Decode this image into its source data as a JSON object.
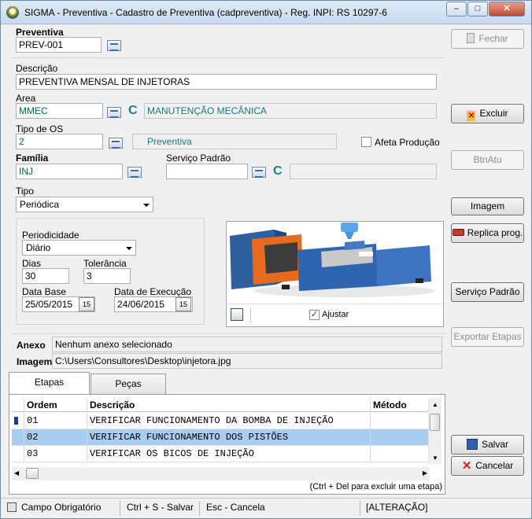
{
  "window": {
    "title": "SIGMA - Preventiva - Cadastro de Preventiva (cadpreventiva) - Reg. INPI: RS 10297-6",
    "controls": [
      "–",
      "□",
      "✕"
    ]
  },
  "form": {
    "preventiva": {
      "label": "Preventiva",
      "value": "PREV-001"
    },
    "descricao": {
      "label": "Descrição",
      "value": "PREVENTIVA MENSAL DE INJETORAS"
    },
    "area": {
      "label": "Area",
      "code": "MMEC",
      "name": "MANUTENÇÃO MECÂNICA"
    },
    "tipo_os": {
      "label": "Tipo de OS",
      "code": "2",
      "name": "Preventiva"
    },
    "afeta_producao": {
      "label": "Afeta Produção",
      "checked": false
    },
    "familia": {
      "label": "Família",
      "value": "INJ"
    },
    "servico_padrao": {
      "label": "Serviço Padrão",
      "value": "",
      "name": ""
    },
    "c_glyph": "C",
    "tipo": {
      "label": "Tipo",
      "selected": "Periódica"
    },
    "periodicidade": {
      "label": "Periodicidade",
      "selected": "Diário"
    },
    "dias": {
      "label": "Dias",
      "value": "30"
    },
    "tolerancia": {
      "label": "Tolerância",
      "value": "3"
    },
    "data_base": {
      "label": "Data Base",
      "value": "25/05/2015"
    },
    "data_execucao": {
      "label": "Data de Execução",
      "value": "24/06/2015"
    },
    "date_btn": "15",
    "ajustar": {
      "label": "Ajustar",
      "checked": true
    },
    "anexo": {
      "label": "Anexo",
      "value": "Nenhum anexo selecionado"
    },
    "imagem": {
      "label": "Imagem",
      "value": "C:\\Users\\Consultores\\Desktop\\injetora.jpg"
    }
  },
  "tabs": [
    {
      "label": "Etapas",
      "active": true
    },
    {
      "label": "Peças",
      "active": false
    }
  ],
  "grid": {
    "columns": [
      "Ordem",
      "Descrição",
      "Método"
    ],
    "rows": [
      {
        "ordem": "01",
        "descricao": "VERIFICAR FUNCIONAMENTO DA BOMBA DE INJEÇÃO",
        "metodo": "",
        "selected": false
      },
      {
        "ordem": "02",
        "descricao": "VERIFICAR FUNCIONAMENTO DOS PISTÕES",
        "metodo": "",
        "selected": true
      },
      {
        "ordem": "03",
        "descricao": "VERIFICAR OS BICOS DE INJEÇÃO",
        "metodo": "",
        "selected": false
      }
    ],
    "hint": "(Ctrl + Del para excluir uma etapa)"
  },
  "buttons": {
    "fechar": "Fechar",
    "excluir": "Excluir",
    "btnatu": "BtnAtu",
    "imagem": "Imagem",
    "replica": "Replica prog.",
    "servico_padrao": "Serviço Padrão",
    "exportar_etapas": "Exportar Etapas",
    "salvar": "Salvar",
    "cancelar": "Cancelar"
  },
  "statusbar": {
    "obrigatorio": "Campo Obrigatório",
    "salvar": "Ctrl + S - Salvar",
    "cancela": "Esc - Cancela",
    "mode": "[ALTERAÇÃO]"
  },
  "colors": {
    "selected_row": "#a9cdf0",
    "lookup_text": "#1a7a7a",
    "close_red": "#c24a30"
  }
}
